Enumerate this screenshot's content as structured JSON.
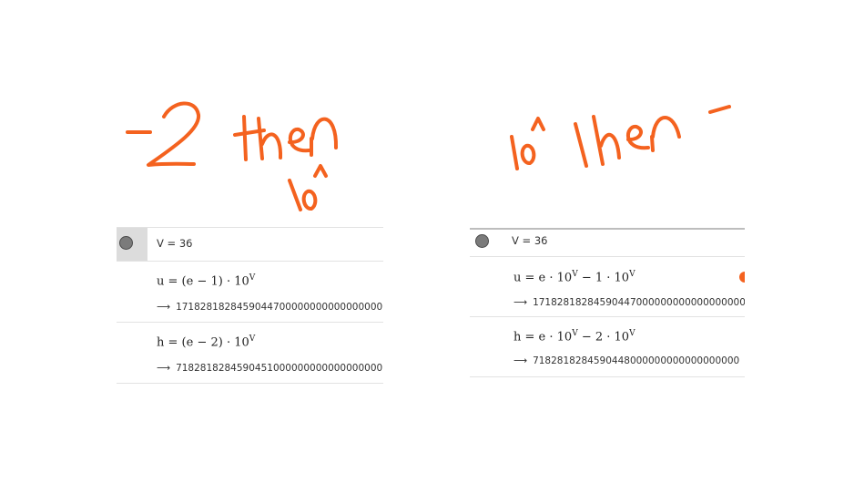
{
  "handwriting": {
    "left": "-2 then 10^",
    "right": "10^ then -"
  },
  "left_panel": {
    "slider": {
      "text": "V = 36"
    },
    "rows": [
      {
        "label": "u",
        "formula": "(e − 1) · 10",
        "exponent": "V",
        "result": "1718281828459044700000000000000000000"
      },
      {
        "label": "h",
        "formula": "(e − 2) · 10",
        "exponent": "V",
        "result": "7182818284590451000000000000000000"
      }
    ]
  },
  "right_panel": {
    "slider": {
      "text": "V = 36"
    },
    "rows": [
      {
        "label": "u",
        "formula_a": "e · 10",
        "exp_a": "V",
        "formula_b": " − 1 · 10",
        "exp_b": "V",
        "result": "1718281828459044700000000000000000000"
      },
      {
        "label": "h",
        "formula_a": "e · 10",
        "exp_a": "V",
        "formula_b": " − 2 · 10",
        "exp_b": "V",
        "result": "7182818284590448000000000000000000"
      }
    ]
  },
  "colors": {
    "ink": "#f4621f",
    "dot": "#7b7b7b",
    "active_gutter": "#dcdcdc"
  },
  "icons": {
    "menu": "kebab-menu-icon",
    "visibility": "visibility-dot-icon",
    "arrow": "right-arrow-icon"
  }
}
